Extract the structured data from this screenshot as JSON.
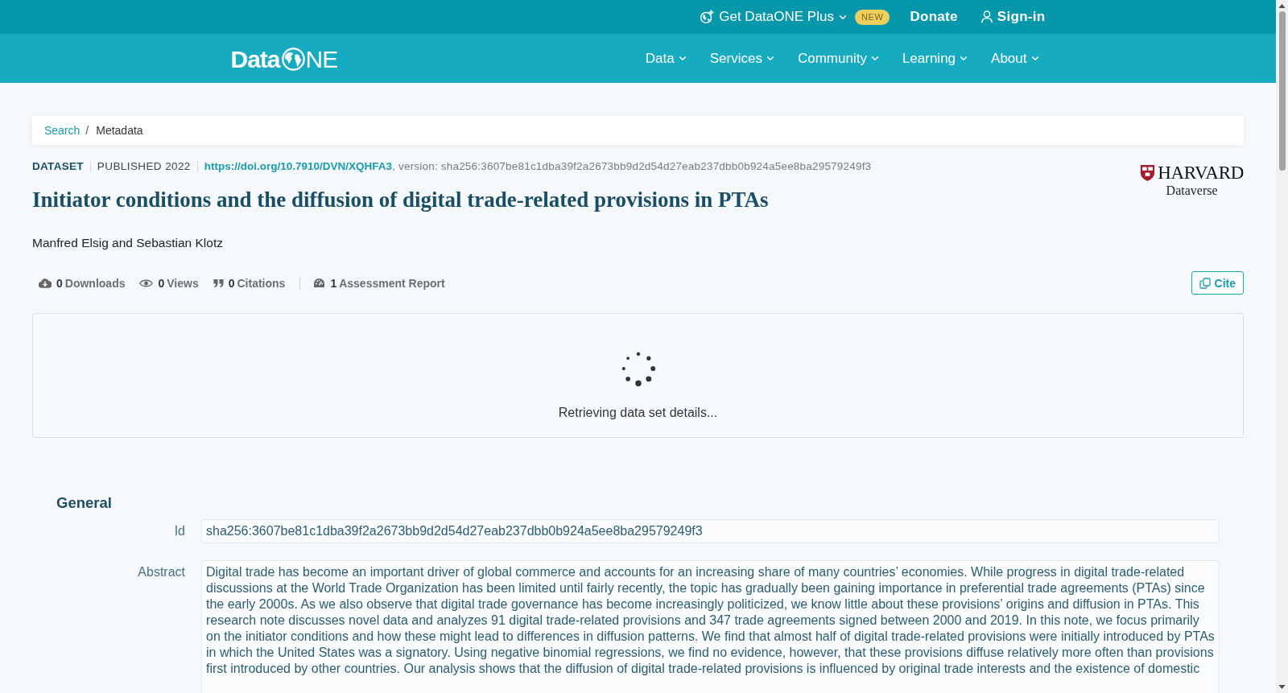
{
  "top_bar": {
    "plus": {
      "label": "Get DataONE Plus",
      "badge": "NEW"
    },
    "donate": {
      "label": "Donate"
    },
    "sign_in": {
      "label": "Sign-in"
    }
  },
  "logo": {
    "bold": "Data",
    "light": "NE"
  },
  "nav": [
    {
      "label": "Data"
    },
    {
      "label": "Services"
    },
    {
      "label": "Community"
    },
    {
      "label": "Learning"
    },
    {
      "label": "About"
    }
  ],
  "breadcrumb": {
    "separator": "/",
    "items": [
      {
        "label": "Search",
        "current": false
      },
      {
        "label": "Metadata",
        "current": true
      }
    ]
  },
  "dataset": {
    "type": "DATASET",
    "published": "PUBLISHED 2022",
    "doi": "https://doi.org/10.7910/DVN/XQHFA3",
    "version": ", version: sha256:3607be81c1dba39f2a2673bb9d2d54d27eab237dbb0b924a5ee8ba29579249f3",
    "title": "Initiator conditions and the diffusion of digital trade-related provisions in PTAs",
    "authors": "Manfred Elsig and Sebastian Klotz"
  },
  "repository": {
    "name": "HARVARD",
    "subtitle": "Dataverse"
  },
  "metrics": [
    {
      "kind": "downloads",
      "count": "0",
      "label": "Downloads"
    },
    {
      "kind": "views",
      "count": "0",
      "label": "Views"
    },
    {
      "kind": "citations",
      "count": "0",
      "label": "Citations"
    },
    {
      "kind": "assessment",
      "count": "1",
      "label": "Assessment Report"
    }
  ],
  "cite_button": {
    "label": "Cite"
  },
  "loading": {
    "message": "Retrieving data set details..."
  },
  "general": {
    "heading": "General",
    "fields": [
      {
        "label": "Id",
        "value": "sha256:3607be81c1dba39f2a2673bb9d2d54d27eab237dbb0b924a5ee8ba29579249f3"
      },
      {
        "label": "Abstract",
        "value": "Digital trade has become an important driver of global commerce and accounts for an increasing share of many countries’ economies. While progress in digital trade-related discussions at the World Trade Organization has been limited until fairly recently, the topic has gradually been gaining importance in preferential trade agreements (PTAs) since the early 2000s. As we also observe that digital trade governance has become increasingly politicized, we know little about these provisions’ origins and diffusion in PTAs. This research note discusses novel data and analyzes 91 digital trade-related provisions and 347 trade agreements signed between 2000 and 2019. In this note, we focus primarily on the initiator conditions and how these might lead to differences in diffusion patterns. We find that almost half of digital trade-related provisions were initially introduced by PTAs in which the United States was a signatory. Using negative binomial regressions, we find no evidence, however, that these provisions diffuse relatively more often than provisions first introduced by other countries. Our analysis shows that the diffusion of digital trade-related provisions is influenced by original trade interests and the existence of domestic"
      }
    ]
  }
}
